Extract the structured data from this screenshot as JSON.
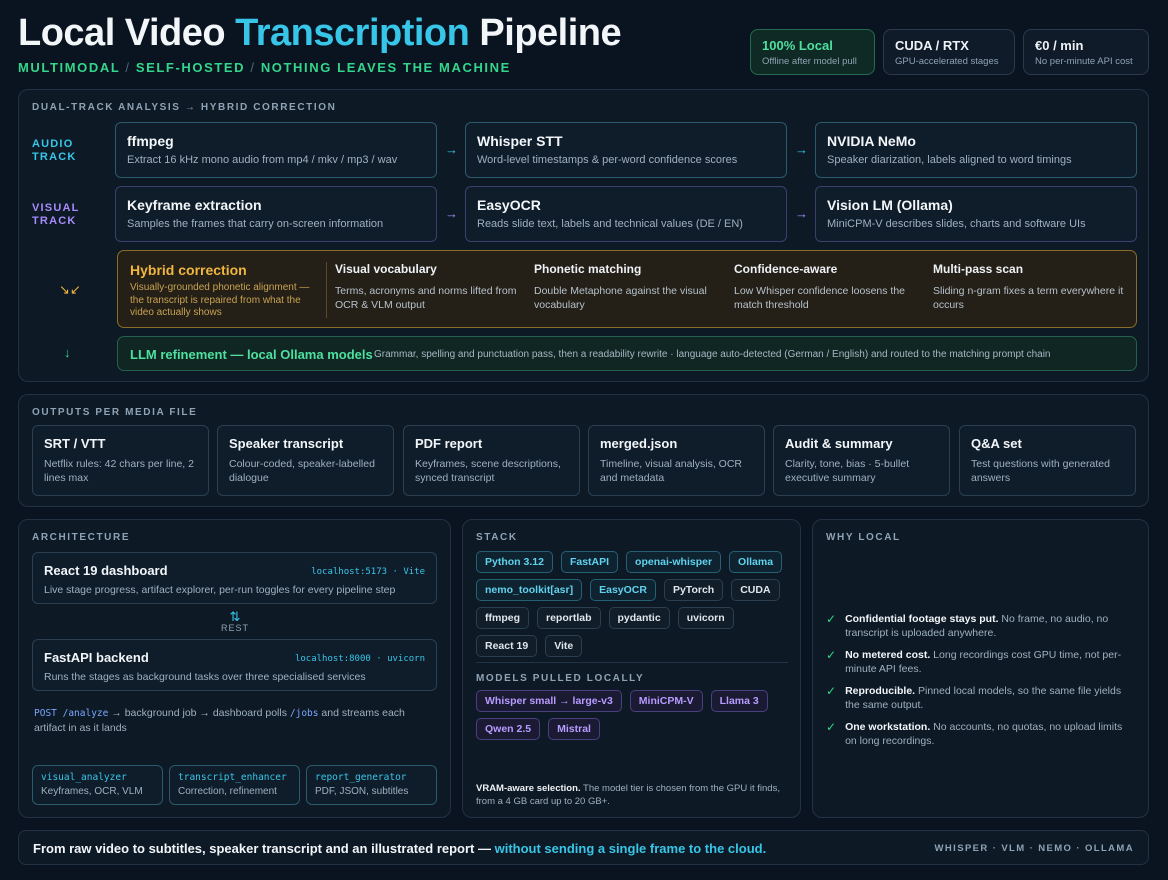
{
  "header": {
    "title_pre": "Local Video ",
    "title_hl": "Transcription",
    "title_post": " Pipeline",
    "subtitle": [
      "MULTIMODAL",
      "SELF-HOSTED",
      "NOTHING LEAVES THE MACHINE"
    ],
    "separator": "/",
    "stats": [
      {
        "value": "100% Local",
        "sub": "Offline after model pull"
      },
      {
        "value": "CUDA / RTX",
        "sub": "GPU-accelerated stages"
      },
      {
        "value": "€0 / min",
        "sub": "No per-minute API cost"
      }
    ]
  },
  "pipeline": {
    "label": "DUAL-TRACK ANALYSIS → HYBRID CORRECTION",
    "audio_track": {
      "label": "AUDIO\nTRACK",
      "stages": [
        {
          "title": "ffmpeg",
          "desc": "Extract 16 kHz mono audio from mp4 / mkv / mp3 / wav"
        },
        {
          "title": "Whisper STT",
          "desc": "Word-level timestamps & per-word confidence scores"
        },
        {
          "title": "NVIDIA NeMo",
          "desc": "Speaker diarization, labels aligned to word timings"
        }
      ]
    },
    "visual_track": {
      "label": "VISUAL\nTRACK",
      "stages": [
        {
          "title": "Keyframe extraction",
          "desc": "Samples the frames that carry on-screen information"
        },
        {
          "title": "EasyOCR",
          "desc": "Reads slide text, labels and technical values (DE / EN)"
        },
        {
          "title": "Vision LM (Ollama)",
          "desc": "MiniCPM-V describes slides, charts and software UIs"
        }
      ]
    },
    "arrow": "→",
    "merge_arrow": "↘↙",
    "down_arrow": "↓",
    "hybrid": {
      "title": "Hybrid correction",
      "desc": "Visually-grounded phonetic alignment — the transcript is repaired from what the video actually shows",
      "columns": [
        {
          "title": "Visual vocabulary",
          "desc": "Terms, acronyms and norms lifted from OCR & VLM output"
        },
        {
          "title": "Phonetic matching",
          "desc": "Double Metaphone against the visual vocabulary"
        },
        {
          "title": "Confidence-aware",
          "desc": "Low Whisper confidence loosens the match threshold"
        },
        {
          "title": "Multi-pass scan",
          "desc": "Sliding n-gram fixes a term everywhere it occurs"
        }
      ]
    },
    "llm": {
      "title": "LLM refinement — local Ollama models",
      "desc": "Grammar, spelling and punctuation pass, then a readability rewrite · language auto-detected (German / English) and routed to the matching prompt chain"
    }
  },
  "outputs": {
    "label": "OUTPUTS PER MEDIA FILE",
    "items": [
      {
        "title": "SRT / VTT",
        "desc": "Netflix rules: 42 chars per line, 2 lines max"
      },
      {
        "title": "Speaker transcript",
        "desc": "Colour-coded, speaker-labelled dialogue"
      },
      {
        "title": "PDF report",
        "desc": "Keyframes, scene descriptions, synced transcript"
      },
      {
        "title": "merged.json",
        "desc": "Timeline, visual analysis, OCR and metadata"
      },
      {
        "title": "Audit & summary",
        "desc": "Clarity, tone, bias · 5-bullet executive summary"
      },
      {
        "title": "Q&A set",
        "desc": "Test questions with generated answers"
      }
    ]
  },
  "architecture": {
    "label": "ARCHITECTURE",
    "dashboard": {
      "title": "React 19 dashboard",
      "addr": "localhost:5173 · Vite",
      "desc": "Live stage progress, artifact explorer, per-run toggles for every pipeline step"
    },
    "rest_icon": "⇅",
    "rest": "REST",
    "backend": {
      "title": "FastAPI backend",
      "addr": "localhost:8000 · uvicorn",
      "desc": "Runs the stages as background tasks over three specialised services"
    },
    "flow": {
      "code1": "POST /analyze",
      "text1": " → background job → dashboard polls ",
      "code2": "/jobs",
      "text2": " and streams each artifact in as it lands"
    },
    "services": [
      {
        "name": "visual_analyzer",
        "role": "Keyframes, OCR, VLM"
      },
      {
        "name": "transcript_enhancer",
        "role": "Correction, refinement"
      },
      {
        "name": "report_generator",
        "role": "PDF, JSON, subtitles"
      }
    ]
  },
  "stack": {
    "label": "STACK",
    "chips": [
      {
        "text": "Python 3.12",
        "style": "cyan"
      },
      {
        "text": "FastAPI",
        "style": "cyan"
      },
      {
        "text": "openai-whisper",
        "style": "cyan"
      },
      {
        "text": "Ollama",
        "style": "cyan"
      },
      {
        "text": "nemo_toolkit[asr]",
        "style": "cyan"
      },
      {
        "text": "EasyOCR",
        "style": "cyan"
      },
      {
        "text": "PyTorch",
        "style": "plain"
      },
      {
        "text": "CUDA",
        "style": "plain"
      },
      {
        "text": "ffmpeg",
        "style": "plain"
      },
      {
        "text": "reportlab",
        "style": "plain"
      },
      {
        "text": "pydantic",
        "style": "plain"
      },
      {
        "text": "uvicorn",
        "style": "plain"
      },
      {
        "text": "React 19",
        "style": "plain"
      },
      {
        "text": "Vite",
        "style": "plain"
      }
    ],
    "models_label": "MODELS PULLED LOCALLY",
    "models": [
      "Whisper small → large-v3",
      "MiniCPM-V",
      "Llama 3",
      "Qwen 2.5",
      "Mistral"
    ],
    "vram_bold": "VRAM-aware selection.",
    "vram_text": " The model tier is chosen from the GPU it finds, from a 4 GB card up to 20 GB+."
  },
  "why": {
    "label": "WHY LOCAL",
    "check": "✓",
    "items": [
      {
        "bold": "Confidential footage stays put.",
        "text": " No frame, no audio, no transcript is uploaded anywhere."
      },
      {
        "bold": "No metered cost.",
        "text": " Long recordings cost GPU time, not per-minute API fees."
      },
      {
        "bold": "Reproducible.",
        "text": " Pinned local models, so the same file yields the same output."
      },
      {
        "bold": "One workstation.",
        "text": " No accounts, no quotas, no upload limits on long recordings."
      }
    ]
  },
  "footer": {
    "text": "From raw video to subtitles, speaker transcript and an illustrated report — ",
    "highlight": "without sending a single frame to the cloud.",
    "right": "WHISPER · VLM · NEMO · OLLAMA"
  },
  "colors": {
    "accent_cyan": "#38c6e8",
    "accent_green": "#33d68a",
    "accent_purple": "#a78bfa",
    "accent_amber": "#f0b63f",
    "background": "#0a1420"
  }
}
